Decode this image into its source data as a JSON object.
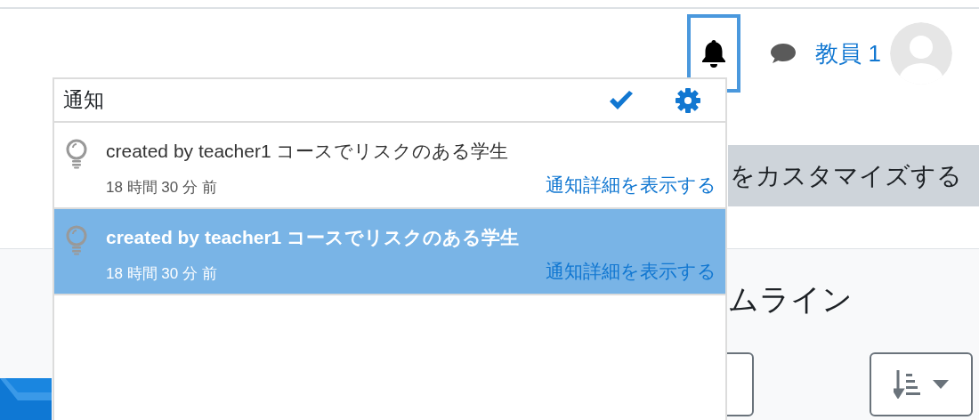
{
  "header": {
    "notifications_open": true,
    "user_name": "教員 1"
  },
  "notification_popover": {
    "title": "通知",
    "items": [
      {
        "text": "created by teacher1 コースでリスクのある学生",
        "time": "18 時間 30 分 前",
        "link": "通知詳細を表示する",
        "selected": false
      },
      {
        "text": "created by teacher1 コースでリスクのある学生",
        "time": "18 時間 30 分 前",
        "link": "通知詳細を表示する",
        "selected": true
      }
    ]
  },
  "page": {
    "customize_button": "をカスタマイズする",
    "section_heading": "ムライン"
  }
}
